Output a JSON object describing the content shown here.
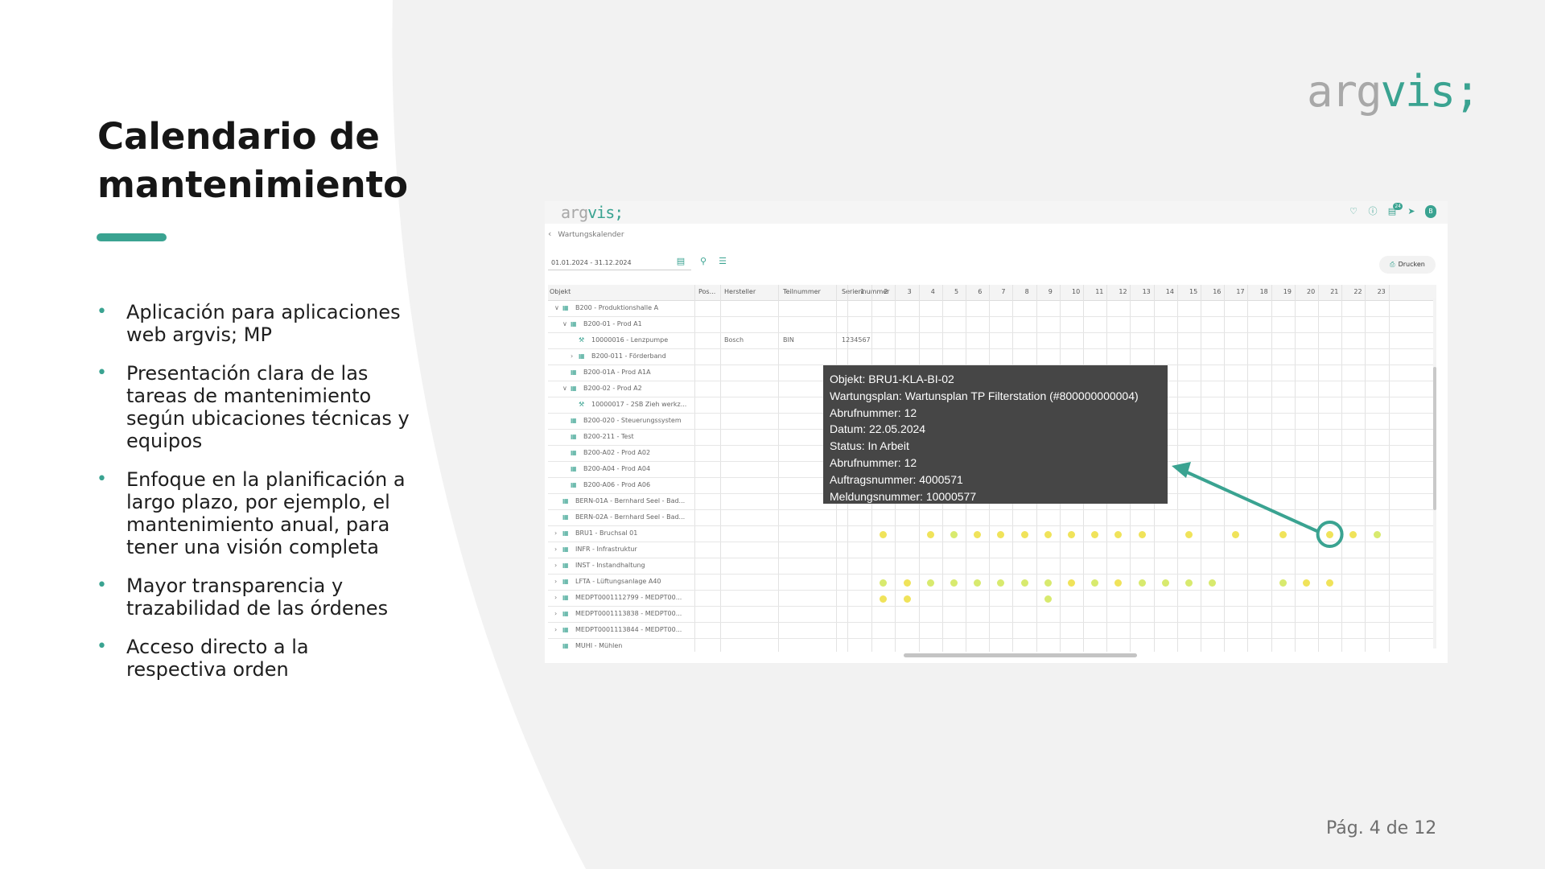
{
  "slide": {
    "title": "Calendario de mantenimiento",
    "bullets": [
      "Aplicación para aplicaciones web argvis; MP",
      "Presentación clara de las tareas de mantenimiento según ubicaciones técnicas y equipos",
      "Enfoque en la planificación a largo plazo, por ejemplo, el mantenimiento anual, para tener una visión completa",
      "Mayor transparencia y trazabilidad de las órdenes",
      "Acceso directo a la respectiva orden"
    ],
    "logo_part1": "arg",
    "logo_part2": "vis;",
    "page_number": "Pág. 4 de 12",
    "accent_color": "#3aa391"
  },
  "app": {
    "logo_part1": "arg",
    "logo_part2": "vis;",
    "header_icons": [
      "bell-icon",
      "info-icon",
      "notes-icon",
      "send-icon",
      "avatar"
    ],
    "notification_badge": "24",
    "avatar_letter": "B",
    "breadcrumb": "Wartungskalender",
    "date_range": "01.01.2024 - 31.12.2024",
    "print_label": "Drucken",
    "columns": {
      "objekt": "Objekt",
      "pos": "Pos...",
      "hersteller": "Hersteller",
      "teilnummer": "Teilnummer",
      "seriennummer": "Seriennummer",
      "days": [
        "1",
        "2",
        "3",
        "4",
        "5",
        "6",
        "7",
        "8",
        "9",
        "10",
        "11",
        "12",
        "13",
        "14",
        "15",
        "16",
        "17",
        "18",
        "19",
        "20",
        "21",
        "22",
        "23"
      ]
    },
    "rows": [
      {
        "label": "B200 - Produktionshalle A",
        "indent": 0,
        "expander": "v",
        "icon": "building-icon"
      },
      {
        "label": "B200-01 - Prod A1",
        "indent": 1,
        "expander": "v",
        "icon": "building-icon"
      },
      {
        "label": "10000016 - Lenzpumpe",
        "indent": 2,
        "expander": "",
        "icon": "wrench-icon",
        "hersteller": "Bosch",
        "teilnummer": "BIN",
        "seriennummer": "1234567"
      },
      {
        "label": "B200-011 - Förderband",
        "indent": 2,
        "expander": ">",
        "icon": "building-icon"
      },
      {
        "label": "B200-01A - Prod A1A",
        "indent": 1,
        "expander": "",
        "icon": "building-icon"
      },
      {
        "label": "B200-02 - Prod A2",
        "indent": 1,
        "expander": "v",
        "icon": "building-icon"
      },
      {
        "label": "10000017 - 2SB Zieh werkz...",
        "indent": 2,
        "expander": "",
        "icon": "wrench-icon"
      },
      {
        "label": "B200-020 - Steuerungssystem",
        "indent": 1,
        "expander": "",
        "icon": "building-icon"
      },
      {
        "label": "B200-211 - Test",
        "indent": 1,
        "expander": "",
        "icon": "building-icon"
      },
      {
        "label": "B200-A02 - Prod A02",
        "indent": 1,
        "expander": "",
        "icon": "building-icon"
      },
      {
        "label": "B200-A04 - Prod A04",
        "indent": 1,
        "expander": "",
        "icon": "building-icon"
      },
      {
        "label": "B200-A06 - Prod A06",
        "indent": 1,
        "expander": "",
        "icon": "building-icon"
      },
      {
        "label": "BERN-01A - Bernhard Seel - Bad...",
        "indent": 0,
        "expander": "",
        "icon": "building-icon"
      },
      {
        "label": "BERN-02A - Bernhard Seel - Bad...",
        "indent": 0,
        "expander": "",
        "icon": "building-icon"
      },
      {
        "label": "BRU1 - Bruchsal 01",
        "indent": 0,
        "expander": ">",
        "icon": "building-icon"
      },
      {
        "label": "INFR - Infrastruktur",
        "indent": 0,
        "expander": ">",
        "icon": "building-icon"
      },
      {
        "label": "INST - Instandhaltung",
        "indent": 0,
        "expander": ">",
        "icon": "building-icon"
      },
      {
        "label": "LFTA - Lüftungsanlage A40",
        "indent": 0,
        "expander": ">",
        "icon": "building-icon"
      },
      {
        "label": "MEDPT0001112799 - MEDPT00...",
        "indent": 0,
        "expander": ">",
        "icon": "building-icon"
      },
      {
        "label": "MEDPT0001113838 - MEDPT00...",
        "indent": 0,
        "expander": ">",
        "icon": "building-icon"
      },
      {
        "label": "MEDPT0001113844 - MEDPT00...",
        "indent": 0,
        "expander": ">",
        "icon": "building-icon"
      },
      {
        "label": "MUHI - Mühlen",
        "indent": 0,
        "expander": "",
        "icon": "building-icon"
      }
    ],
    "schedule": [
      {
        "row": 14,
        "day": 2,
        "color": "#f0e35a"
      },
      {
        "row": 14,
        "day": 4,
        "color": "#f0e35a"
      },
      {
        "row": 14,
        "day": 5,
        "color": "#d8ea6e"
      },
      {
        "row": 14,
        "day": 6,
        "color": "#f0e35a"
      },
      {
        "row": 14,
        "day": 7,
        "color": "#f0e35a"
      },
      {
        "row": 14,
        "day": 8,
        "color": "#f0e35a"
      },
      {
        "row": 14,
        "day": 9,
        "color": "#f0e35a"
      },
      {
        "row": 14,
        "day": 10,
        "color": "#f0e35a"
      },
      {
        "row": 14,
        "day": 11,
        "color": "#f0e35a"
      },
      {
        "row": 14,
        "day": 12,
        "color": "#f0e35a"
      },
      {
        "row": 14,
        "day": 13,
        "color": "#f0e35a"
      },
      {
        "row": 14,
        "day": 15,
        "color": "#f0e35a"
      },
      {
        "row": 14,
        "day": 17,
        "color": "#f0e35a"
      },
      {
        "row": 14,
        "day": 19,
        "color": "#f0e35a"
      },
      {
        "row": 14,
        "day": 21,
        "color": "#f0e35a"
      },
      {
        "row": 14,
        "day": 22,
        "color": "#f0e35a"
      },
      {
        "row": 14,
        "day": 23,
        "color": "#d8ea6e"
      },
      {
        "row": 17,
        "day": 2,
        "color": "#d8ea6e"
      },
      {
        "row": 17,
        "day": 3,
        "color": "#f0e35a"
      },
      {
        "row": 17,
        "day": 4,
        "color": "#d8ea6e"
      },
      {
        "row": 17,
        "day": 5,
        "color": "#d8ea6e"
      },
      {
        "row": 17,
        "day": 6,
        "color": "#d8ea6e"
      },
      {
        "row": 17,
        "day": 7,
        "color": "#d8ea6e"
      },
      {
        "row": 17,
        "day": 8,
        "color": "#d8ea6e"
      },
      {
        "row": 17,
        "day": 9,
        "color": "#d8ea6e"
      },
      {
        "row": 17,
        "day": 10,
        "color": "#f0e35a"
      },
      {
        "row": 17,
        "day": 11,
        "color": "#d8ea6e"
      },
      {
        "row": 17,
        "day": 12,
        "color": "#f0e35a"
      },
      {
        "row": 17,
        "day": 13,
        "color": "#d8ea6e"
      },
      {
        "row": 17,
        "day": 14,
        "color": "#d8ea6e"
      },
      {
        "row": 17,
        "day": 15,
        "color": "#d8ea6e"
      },
      {
        "row": 17,
        "day": 16,
        "color": "#d8ea6e"
      },
      {
        "row": 17,
        "day": 19,
        "color": "#d8ea6e"
      },
      {
        "row": 17,
        "day": 20,
        "color": "#f0e35a"
      },
      {
        "row": 17,
        "day": 21,
        "color": "#f0e35a"
      },
      {
        "row": 18,
        "day": 2,
        "color": "#f0e35a"
      },
      {
        "row": 18,
        "day": 3,
        "color": "#f0e35a"
      },
      {
        "row": 18,
        "day": 9,
        "color": "#d8ea6e"
      }
    ],
    "tooltip": [
      "Objekt: BRU1-KLA-BI-02",
      "Wartungsplan: Wartunsplan TP Filterstation (#800000000004)",
      "Abrufnummer: 12",
      "Datum: 22.05.2024",
      "Status: In Arbeit",
      "Abrufnummer: 12",
      "Auftragsnummer: 4000571",
      "Meldungsnummer: 10000577"
    ],
    "highlight": {
      "row": 14,
      "day": 21
    }
  }
}
